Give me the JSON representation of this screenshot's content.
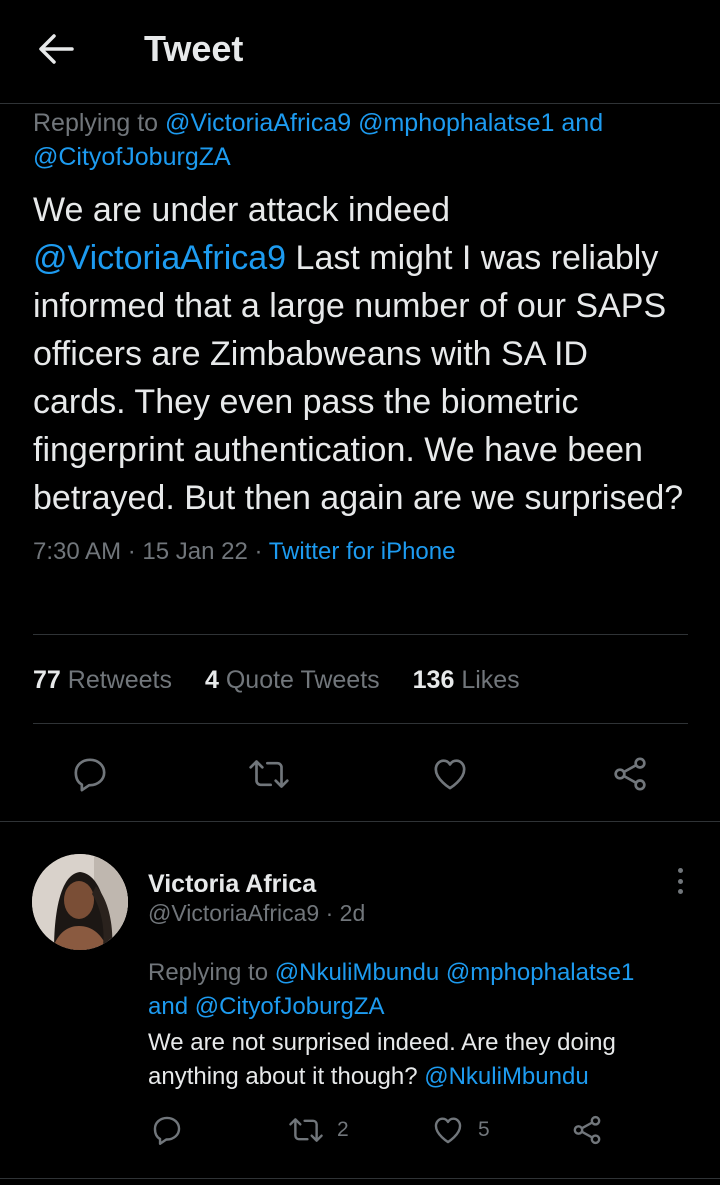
{
  "header": {
    "title": "Tweet",
    "back_icon": "arrow-left-icon"
  },
  "tweet": {
    "replying_prefix": "Replying to ",
    "replying_to": [
      "@VictoriaAfrica9",
      "@mphophalatse1",
      "and",
      "@CityofJoburgZA"
    ],
    "text_before": "We are under attack indeed ",
    "mention": "@VictoriaAfrica9",
    "text_after": " Last might I was reliably informed that a large number of our SAPS officers are Zimbabweans with SA ID cards. They even pass the biometric fingerprint authentication. We have been betrayed. But then again are we surprised?",
    "time": "7:30 AM",
    "separator": " · ",
    "date": "15 Jan 22",
    "source": "Twitter for iPhone"
  },
  "stats": {
    "retweets_count": "77",
    "retweets_label": "Retweets",
    "quotes_count": "4",
    "quotes_label": "Quote Tweets",
    "likes_count": "136",
    "likes_label": "Likes"
  },
  "actions": [
    "reply-icon",
    "retweet-icon",
    "like-icon",
    "share-icon"
  ],
  "reply": {
    "name": "Victoria Africa",
    "handle": "@VictoriaAfrica9",
    "age_sep": " · ",
    "age": "2d",
    "replying_prefix": "Replying to ",
    "replying_to": [
      "@NkuliMbundu",
      "@mphophalatse1",
      "and",
      "@CityofJoburgZA"
    ],
    "text": "We are not surprised indeed. Are they doing anything about it though? ",
    "mention": "@NkuliMbundu",
    "retweet_count": "2",
    "like_count": "5"
  },
  "colors": {
    "background": "#000000",
    "text": "#e7e9ea",
    "secondary": "#71767b",
    "accent": "#1d9bf0",
    "divider": "#2f3336"
  }
}
